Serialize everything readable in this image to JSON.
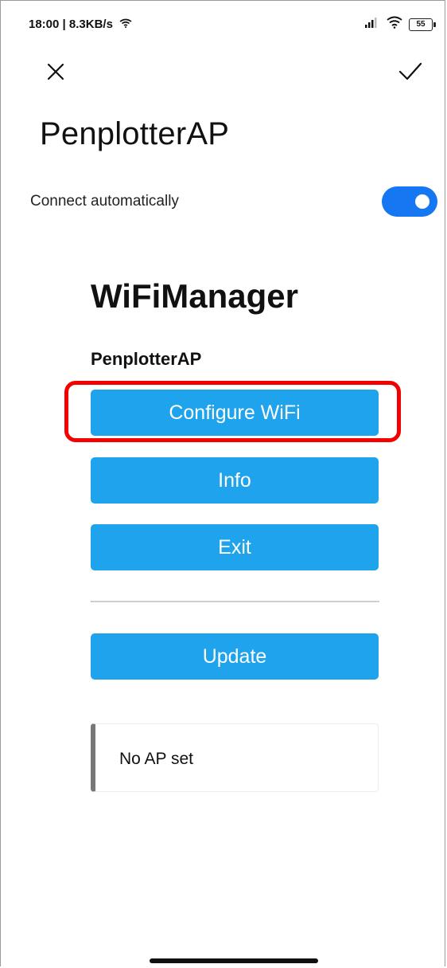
{
  "status_bar": {
    "time": "18:00 | 8.3KB/s",
    "battery": "55"
  },
  "header": {
    "title": "PenplotterAP",
    "auto_connect_label": "Connect automatically",
    "auto_connect_on": true,
    "accent_color": "#1677f2"
  },
  "web": {
    "title": "WiFiManager",
    "ssid": "PenplotterAP",
    "buttons": {
      "configure": "Configure WiFi",
      "info": "Info",
      "exit": "Exit",
      "update": "Update"
    },
    "button_color": "#1fa3ec",
    "highlight_color": "#f50000",
    "message": "No AP set"
  }
}
